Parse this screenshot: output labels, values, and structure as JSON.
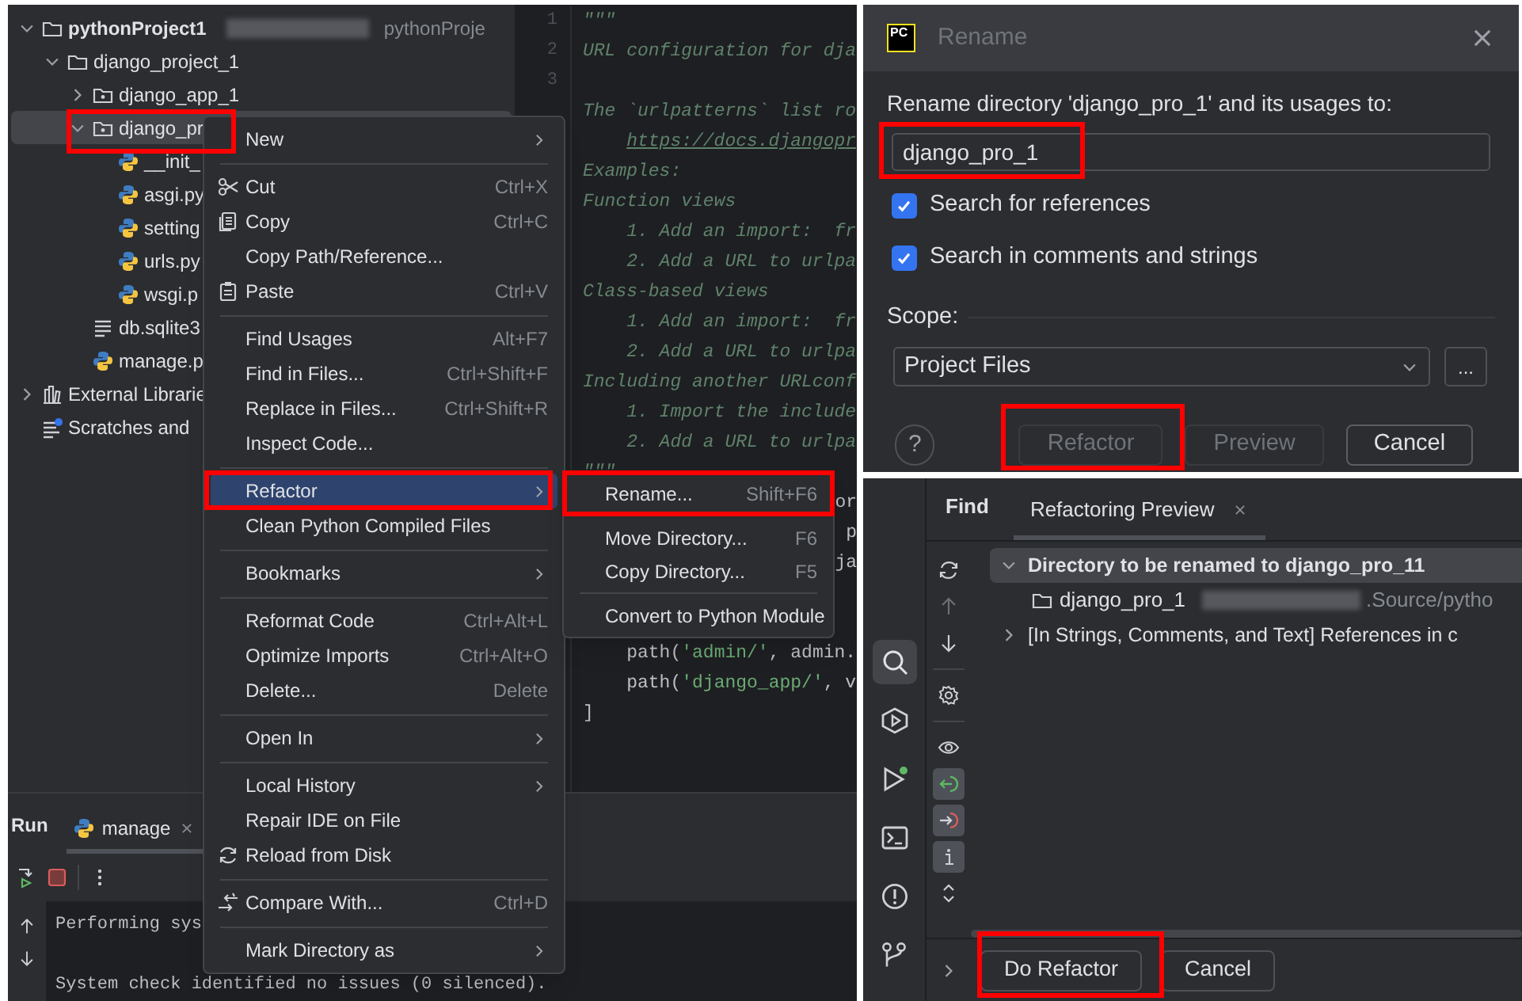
{
  "project_tree": {
    "items": [
      {
        "kind": "root",
        "label": "pythonProject1",
        "suffix": "pythonProje",
        "expanded": true,
        "selected": false,
        "children": [
          {
            "kind": "folder",
            "label": "django_project_1",
            "expanded": true,
            "selected": false,
            "children": [
              {
                "kind": "package",
                "label": "django_app_1",
                "expanded": false,
                "selected": false
              },
              {
                "kind": "package",
                "label": "django_pr",
                "expanded": true,
                "selected": true,
                "children": [
                  {
                    "kind": "python",
                    "label": "__init_",
                    "selected": false
                  },
                  {
                    "kind": "python",
                    "label": "asgi.py",
                    "selected": false
                  },
                  {
                    "kind": "python",
                    "label": "setting",
                    "selected": false
                  },
                  {
                    "kind": "python",
                    "label": "urls.py",
                    "selected": false
                  },
                  {
                    "kind": "python",
                    "label": "wsgi.p",
                    "selected": false
                  }
                ]
              },
              {
                "kind": "text",
                "label": "db.sqlite3",
                "selected": false
              },
              {
                "kind": "python",
                "label": "manage.p",
                "selected": false
              }
            ]
          }
        ]
      },
      {
        "kind": "library",
        "label": "External Librarie",
        "expanded": false,
        "selected": false
      },
      {
        "kind": "scratch",
        "label": "Scratches and",
        "selected": false
      }
    ]
  },
  "editor": {
    "line_numbers": [
      "1",
      "2",
      "3"
    ],
    "lines": [
      {
        "kind": "code",
        "tokens": [
          {
            "kind": "doc",
            "text": "\"\"\""
          }
        ]
      },
      {
        "kind": "code",
        "tokens": [
          {
            "kind": "doc",
            "text": "URL configuration for dja"
          }
        ]
      },
      {
        "kind": "blank"
      },
      {
        "kind": "code",
        "tokens": [
          {
            "kind": "doc",
            "text": "The `urlpatterns` list ro"
          }
        ]
      },
      {
        "kind": "indented",
        "tokens": [
          {
            "kind": "link",
            "text": "https://docs.djangopr"
          }
        ]
      },
      {
        "kind": "code",
        "tokens": [
          {
            "kind": "doc",
            "text": "Examples:"
          }
        ]
      },
      {
        "kind": "code",
        "tokens": [
          {
            "kind": "doc",
            "text": "Function views"
          }
        ]
      },
      {
        "kind": "code",
        "tokens": [
          {
            "kind": "doc",
            "text": "    1. Add an import:  fr"
          }
        ]
      },
      {
        "kind": "code",
        "tokens": [
          {
            "kind": "doc",
            "text": "    2. Add a URL to urlpa"
          }
        ]
      },
      {
        "kind": "code",
        "tokens": [
          {
            "kind": "doc",
            "text": "Class-based views"
          }
        ]
      },
      {
        "kind": "code",
        "tokens": [
          {
            "kind": "doc",
            "text": "    1. Add an import:  fr"
          }
        ]
      },
      {
        "kind": "code",
        "tokens": [
          {
            "kind": "doc",
            "text": "    2. Add a URL to urlpa"
          }
        ]
      },
      {
        "kind": "code",
        "tokens": [
          {
            "kind": "doc",
            "text": "Including another URLconf"
          }
        ]
      },
      {
        "kind": "code",
        "tokens": [
          {
            "kind": "doc",
            "text": "    1. Import the include"
          }
        ]
      },
      {
        "kind": "code",
        "tokens": [
          {
            "kind": "doc",
            "text": "    2. Add a URL to urlpa"
          }
        ]
      },
      {
        "kind": "code",
        "tokens": [
          {
            "kind": "doc",
            "text": "\"\"\""
          }
        ]
      },
      {
        "kind": "fragment",
        "tokens": [
          {
            "kind": "plain",
            "text": "or"
          }
        ]
      },
      {
        "kind": "fragment",
        "tokens": [
          {
            "kind": "plain",
            "text": "p"
          }
        ]
      },
      {
        "kind": "fragment",
        "tokens": [
          {
            "kind": "plain",
            "text": "ja"
          }
        ]
      },
      {
        "kind": "blank"
      },
      {
        "kind": "blank"
      },
      {
        "kind": "code",
        "tokens": [
          {
            "kind": "plain",
            "text": "    path("
          },
          {
            "kind": "string",
            "text": "'admin/'"
          },
          {
            "kind": "plain",
            "text": ", admin."
          }
        ]
      },
      {
        "kind": "code",
        "tokens": [
          {
            "kind": "plain",
            "text": "    path("
          },
          {
            "kind": "string",
            "text": "'django_app/'"
          },
          {
            "kind": "plain",
            "text": ", v"
          }
        ]
      },
      {
        "kind": "code",
        "tokens": [
          {
            "kind": "plain",
            "text": "]"
          }
        ]
      }
    ]
  },
  "run_panel": {
    "title": "Run",
    "tabs": [
      {
        "label": "manage",
        "selected": true
      }
    ],
    "console": [
      "Performing sys",
      "System check identified no issues (0 silenced)."
    ]
  },
  "context_menu": {
    "items": [
      {
        "kind": "item",
        "label": "New",
        "submenu": true,
        "selected": false
      },
      {
        "kind": "separator"
      },
      {
        "kind": "item",
        "label": "Cut",
        "shortcut": "Ctrl+X",
        "selected": false
      },
      {
        "kind": "item",
        "label": "Copy",
        "shortcut": "Ctrl+C",
        "selected": false
      },
      {
        "kind": "item",
        "label": "Copy Path/Reference...",
        "selected": false
      },
      {
        "kind": "item",
        "label": "Paste",
        "shortcut": "Ctrl+V",
        "selected": false
      },
      {
        "kind": "separator"
      },
      {
        "kind": "item",
        "label": "Find Usages",
        "shortcut": "Alt+F7",
        "selected": false
      },
      {
        "kind": "item",
        "label": "Find in Files...",
        "shortcut": "Ctrl+Shift+F",
        "selected": false
      },
      {
        "kind": "item",
        "label": "Replace in Files...",
        "shortcut": "Ctrl+Shift+R",
        "selected": false
      },
      {
        "kind": "item",
        "label": "Inspect Code...",
        "selected": false
      },
      {
        "kind": "separator"
      },
      {
        "kind": "item",
        "label": "Refactor",
        "submenu": true,
        "selected": true
      },
      {
        "kind": "item",
        "label": "Clean Python Compiled Files",
        "selected": false
      },
      {
        "kind": "separator"
      },
      {
        "kind": "item",
        "label": "Bookmarks",
        "submenu": true,
        "selected": false
      },
      {
        "kind": "separator"
      },
      {
        "kind": "item",
        "label": "Reformat Code",
        "shortcut": "Ctrl+Alt+L",
        "selected": false
      },
      {
        "kind": "item",
        "label": "Optimize Imports",
        "shortcut": "Ctrl+Alt+O",
        "selected": false
      },
      {
        "kind": "item",
        "label": "Delete...",
        "shortcut": "Delete",
        "selected": false
      },
      {
        "kind": "separator"
      },
      {
        "kind": "item",
        "label": "Open In",
        "submenu": true,
        "selected": false
      },
      {
        "kind": "separator"
      },
      {
        "kind": "item",
        "label": "Local History",
        "submenu": true,
        "selected": false
      },
      {
        "kind": "item",
        "label": "Repair IDE on File",
        "selected": false
      },
      {
        "kind": "item",
        "label": "Reload from Disk",
        "selected": false
      },
      {
        "kind": "separator"
      },
      {
        "kind": "item",
        "label": "Compare With...",
        "shortcut": "Ctrl+D",
        "selected": false
      },
      {
        "kind": "separator"
      },
      {
        "kind": "item",
        "label": "Mark Directory as",
        "submenu": true,
        "selected": false
      }
    ]
  },
  "refactor_submenu": {
    "items": [
      {
        "kind": "item",
        "label": "Rename...",
        "shortcut": "Shift+F6",
        "selected": false
      },
      {
        "kind": "separator"
      },
      {
        "kind": "item",
        "label": "Move Directory...",
        "shortcut": "F6",
        "selected": false
      },
      {
        "kind": "item",
        "label": "Copy Directory...",
        "shortcut": "F5",
        "selected": false
      },
      {
        "kind": "separator"
      },
      {
        "kind": "item",
        "label": "Convert to Python Module",
        "selected": false
      }
    ]
  },
  "rename_dialog": {
    "logo": "PC",
    "title": "Rename",
    "prompt": "Rename directory 'django_pro_1' and its usages to:",
    "name_value": "django_pro_1",
    "options": [
      {
        "label": "Search for references",
        "checked": true
      },
      {
        "label": "Search in comments and strings",
        "checked": true
      }
    ],
    "scope_label": "Scope:",
    "scope_value": "Project Files",
    "browse_button": "...",
    "help_button": "?",
    "buttons": [
      {
        "label": "Refactor",
        "disabled": true
      },
      {
        "label": "Preview",
        "disabled": true
      },
      {
        "label": "Cancel",
        "disabled": false
      }
    ]
  },
  "refactoring_preview": {
    "title": "Find",
    "tabs": [
      {
        "label": "Refactoring Preview",
        "selected": true
      }
    ],
    "side_strip": [
      {
        "selected": true
      },
      {
        "selected": false
      },
      {
        "selected": false
      },
      {
        "selected": false
      },
      {
        "selected": false
      },
      {
        "selected": false
      }
    ],
    "toolbar": [
      {
        "kind": "button",
        "disabled": false,
        "on": false
      },
      {
        "kind": "button",
        "disabled": true,
        "on": false
      },
      {
        "kind": "button",
        "disabled": false,
        "on": false
      },
      {
        "kind": "separator"
      },
      {
        "kind": "button",
        "disabled": false,
        "on": false
      },
      {
        "kind": "separator"
      },
      {
        "kind": "button",
        "disabled": false,
        "on": false
      },
      {
        "kind": "button",
        "disabled": false,
        "on": true
      },
      {
        "kind": "button",
        "disabled": false,
        "on": true
      },
      {
        "kind": "button",
        "disabled": false,
        "on": true
      },
      {
        "kind": "button",
        "disabled": false,
        "on": false
      }
    ],
    "tree": [
      {
        "label": "Directory to be renamed to django_pro_11",
        "expanded": true,
        "selected": true,
        "children": [
          {
            "label": "django_pro_1",
            "location": ".Source/pytho",
            "selected": false
          }
        ]
      },
      {
        "label": "[In Strings, Comments, and Text] References in c",
        "expanded": false,
        "selected": false
      }
    ],
    "buttons": [
      {
        "label": "Do Refactor"
      },
      {
        "label": "Cancel"
      }
    ]
  }
}
